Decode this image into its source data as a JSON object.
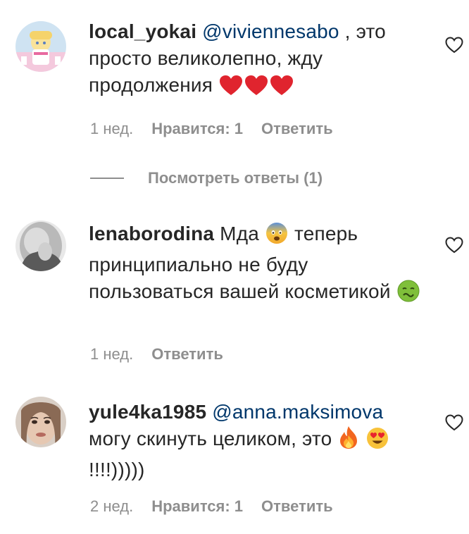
{
  "comments": [
    {
      "username": "local_yokai",
      "mention": "@viviennesabo",
      "text_after_mention": " , это просто великолепно, жду продолжения",
      "emojis": [
        "heart-emoji",
        "heart-emoji",
        "heart-emoji"
      ],
      "time": "1 нед.",
      "likes_label": "Нравится: 1",
      "reply_label": "Ответить"
    },
    {
      "username": "lenaborodina",
      "text_before_emoji": " Мда",
      "emoji1": "fearful-face-emoji",
      "text_after_emoji": " теперь принципиально не буду пользоваться вашей косметикой",
      "emoji2": "nauseated-face-emoji",
      "time": "1 нед.",
      "reply_label": "Ответить"
    },
    {
      "username": "yule4ka1985",
      "mention": "@anna.maksimova",
      "text_after_mention": " могу скинуть целиком, это",
      "emoji1": "fire-emoji",
      "emoji2": "heart-eyes-emoji",
      "text_end": "!!!!)))))",
      "time": "2 нед.",
      "likes_label": "Нравится: 1",
      "reply_label": "Ответить"
    }
  ],
  "view_replies_label": "Посмотреть ответы (1)",
  "colors": {
    "text": "#262626",
    "mention": "#00376b",
    "secondary": "#8e8e8e",
    "heart_red": "#ed4956"
  }
}
